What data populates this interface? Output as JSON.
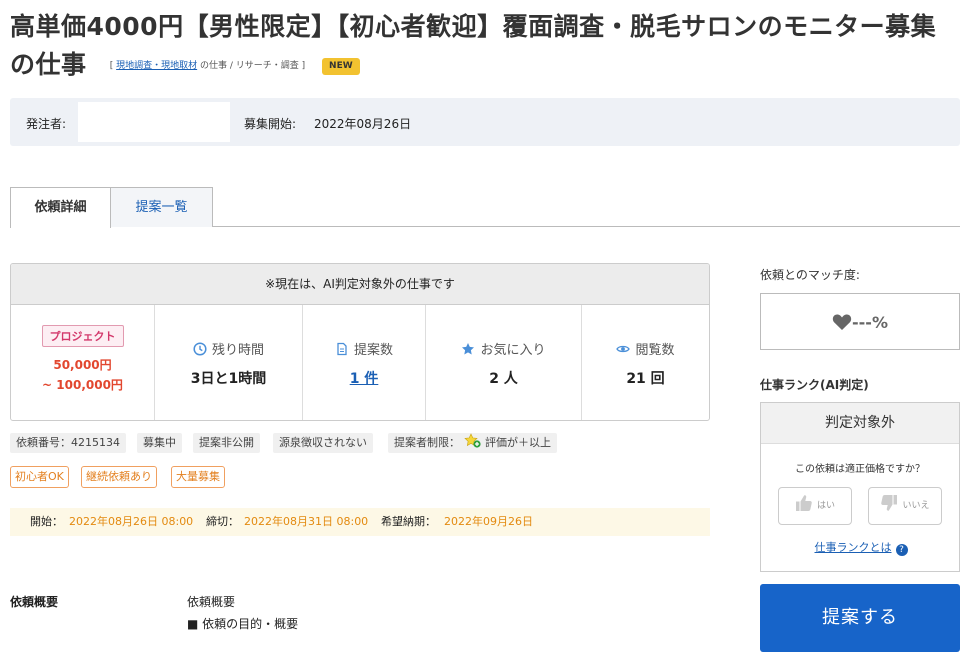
{
  "title": "高単価4000円【男性限定】【初心者歓迎】覆面調査・脱毛サロンのモニター募集の仕事",
  "category": {
    "open": "[",
    "link": "現地調査・現地取材",
    "suffix": "の仕事 / リサーチ・調査",
    "close": "]"
  },
  "new_badge": "NEW",
  "info": {
    "client_label": "発注者:",
    "start_label": "募集開始:",
    "start_date": "2022年08月26日"
  },
  "tabs": [
    {
      "label": "依頼詳細",
      "active": true
    },
    {
      "label": "提案一覧",
      "active": false
    }
  ],
  "ai_notice": "※現在は、AI判定対象外の仕事です",
  "project": {
    "badge": "プロジェクト",
    "price_min": "50,000円",
    "price_max": "~ 100,000円"
  },
  "stats": {
    "remaining": {
      "label": "残り時間",
      "value": "3日と1時間",
      "icon": "clock-icon"
    },
    "proposals": {
      "label": "提案数",
      "value": "1 件",
      "icon": "document-icon"
    },
    "favorites": {
      "label": "お気に入り",
      "value": "2 人",
      "icon": "star-icon"
    },
    "views": {
      "label": "閲覧数",
      "value": "21 回",
      "icon": "eye-icon"
    }
  },
  "chips": {
    "request_no": "依頼番号：4215134",
    "status": "募集中",
    "proposal_private": "提案非公開",
    "withholding": "源泉徴収されない",
    "restriction_label": "提案者制限：",
    "restriction_value": "評価が＋以上"
  },
  "tags": [
    "初心者OK",
    "継続依頼あり",
    "大量募集"
  ],
  "dates": {
    "start_label": "開始：",
    "start": "2022年08月26日 08:00",
    "deadline_label": "締切：",
    "deadline": "2022年08月31日 08:00",
    "delivery_label": "希望納期：",
    "delivery": "2022年09月26日"
  },
  "overview": {
    "section_title": "依頼概要",
    "heading": "依頼概要",
    "item": "■ 依頼の目的・概要"
  },
  "sidebar": {
    "match_label": "依頼とのマッチ度:",
    "match_value": "---%",
    "rank_label": "仕事ランク(AI判定)",
    "rank_value": "判定対象外",
    "question": "この依頼は適正価格ですか？",
    "yes": "はい",
    "no": "いいえ",
    "rank_link": "仕事ランクとは",
    "help": "?",
    "propose_button": "提案する"
  },
  "colors": {
    "accent_blue": "#1764c9",
    "link_blue": "#1a5fb4",
    "price_red": "#e2472f",
    "tag_orange": "#e38020",
    "date_orange": "#e38a10",
    "new_yellow": "#f2c230"
  }
}
